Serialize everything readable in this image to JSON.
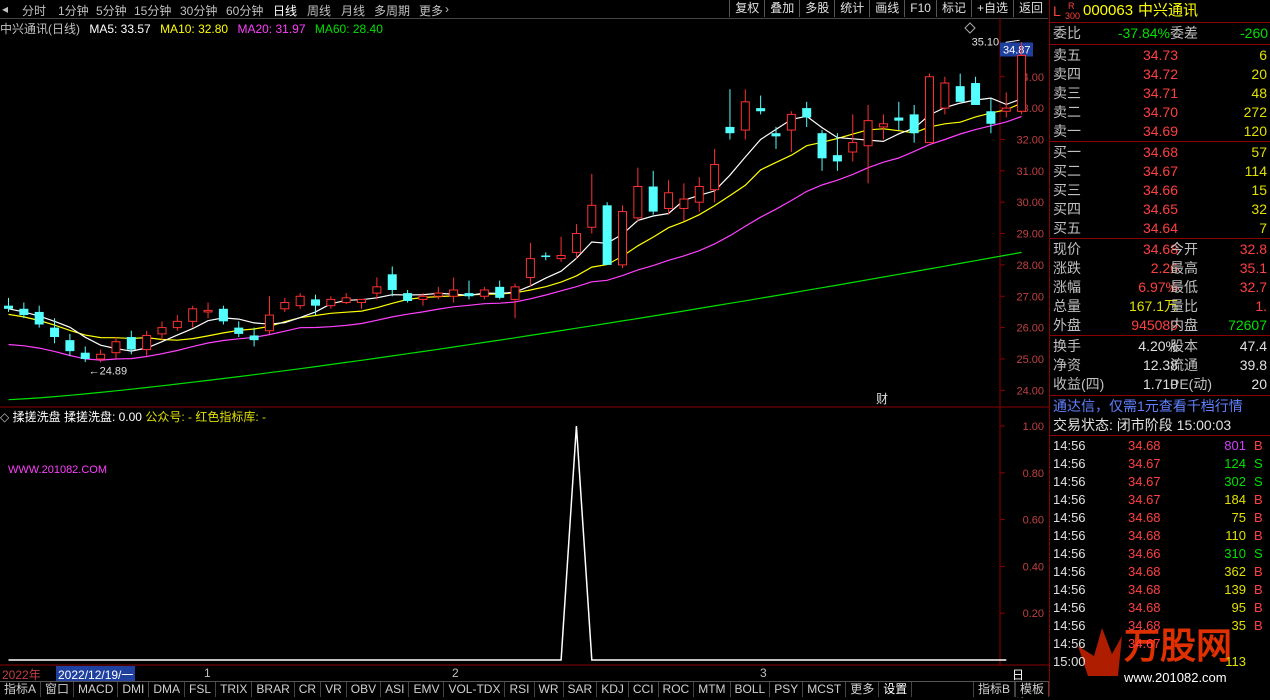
{
  "toolbar": {
    "periods": [
      "分时",
      "1分钟",
      "5分钟",
      "15分钟",
      "30分钟",
      "60分钟",
      "日线",
      "周线",
      "月线",
      "多周期",
      "更多"
    ],
    "active_period": "日线",
    "buttons": [
      "复权",
      "叠加",
      "多股",
      "统计",
      "画线",
      "F10",
      "标记",
      "+自选",
      "返回"
    ]
  },
  "main_legend": {
    "title": "中兴通讯(日线)",
    "ma5": "MA5: 33.57",
    "ma10": "MA10: 32.80",
    "ma20": "MA20: 31.97",
    "ma60": "MA60: 28.40",
    "colors": {
      "ma5": "#ffffff",
      "ma10": "#ffff00",
      "ma20": "#ff40ff",
      "ma60": "#00e000"
    }
  },
  "chart_data": [
    {
      "type": "candlestick",
      "title": "中兴通讯(日线)",
      "y_ticks": [
        "34.00",
        "33.00",
        "32.00",
        "31.00",
        "30.00",
        "29.00",
        "28.00",
        "27.00",
        "26.00",
        "25.00",
        "24.00"
      ],
      "ylim": [
        23.5,
        35.3
      ],
      "price_tag": "34.87",
      "annotations": {
        "high": "35.10",
        "low": "24.89",
        "marker": "财"
      },
      "candles": [
        {
          "o": 26.7,
          "h": 26.95,
          "l": 26.5,
          "c": 26.6
        },
        {
          "o": 26.6,
          "h": 26.8,
          "l": 26.3,
          "c": 26.4
        },
        {
          "o": 26.5,
          "h": 26.7,
          "l": 26.0,
          "c": 26.1
        },
        {
          "o": 26.0,
          "h": 26.3,
          "l": 25.5,
          "c": 25.7
        },
        {
          "o": 25.6,
          "h": 25.8,
          "l": 25.1,
          "c": 25.25
        },
        {
          "o": 25.2,
          "h": 25.4,
          "l": 24.9,
          "c": 25.0
        },
        {
          "o": 25.0,
          "h": 25.3,
          "l": 24.89,
          "c": 25.15
        },
        {
          "o": 25.2,
          "h": 25.7,
          "l": 25.0,
          "c": 25.55
        },
        {
          "o": 25.7,
          "h": 25.9,
          "l": 25.15,
          "c": 25.3
        },
        {
          "o": 25.3,
          "h": 25.9,
          "l": 25.1,
          "c": 25.75
        },
        {
          "o": 25.8,
          "h": 26.2,
          "l": 25.6,
          "c": 26.0
        },
        {
          "o": 26.0,
          "h": 26.4,
          "l": 25.9,
          "c": 26.2
        },
        {
          "o": 26.2,
          "h": 26.7,
          "l": 26.0,
          "c": 26.6
        },
        {
          "o": 26.5,
          "h": 26.8,
          "l": 26.3,
          "c": 26.55
        },
        {
          "o": 26.6,
          "h": 26.7,
          "l": 26.1,
          "c": 26.2
        },
        {
          "o": 26.0,
          "h": 26.2,
          "l": 25.7,
          "c": 25.8
        },
        {
          "o": 25.75,
          "h": 26.0,
          "l": 25.4,
          "c": 25.6
        },
        {
          "o": 25.9,
          "h": 27.0,
          "l": 25.8,
          "c": 26.4
        },
        {
          "o": 26.6,
          "h": 26.95,
          "l": 26.5,
          "c": 26.8
        },
        {
          "o": 26.7,
          "h": 27.1,
          "l": 26.6,
          "c": 27.0
        },
        {
          "o": 26.9,
          "h": 27.05,
          "l": 26.4,
          "c": 26.7
        },
        {
          "o": 26.7,
          "h": 27.0,
          "l": 26.6,
          "c": 26.9
        },
        {
          "o": 26.8,
          "h": 27.1,
          "l": 26.75,
          "c": 26.95
        },
        {
          "o": 26.8,
          "h": 26.9,
          "l": 26.6,
          "c": 26.9
        },
        {
          "o": 27.1,
          "h": 27.6,
          "l": 26.9,
          "c": 27.3
        },
        {
          "o": 27.7,
          "h": 27.95,
          "l": 27.0,
          "c": 27.2
        },
        {
          "o": 27.1,
          "h": 27.2,
          "l": 26.8,
          "c": 26.85
        },
        {
          "o": 26.9,
          "h": 27.1,
          "l": 26.7,
          "c": 27.0
        },
        {
          "o": 27.0,
          "h": 27.3,
          "l": 26.9,
          "c": 27.1
        },
        {
          "o": 27.0,
          "h": 27.6,
          "l": 26.8,
          "c": 27.2
        },
        {
          "o": 27.1,
          "h": 27.5,
          "l": 26.9,
          "c": 27.0
        },
        {
          "o": 27.0,
          "h": 27.3,
          "l": 26.9,
          "c": 27.2
        },
        {
          "o": 27.3,
          "h": 27.5,
          "l": 26.9,
          "c": 26.95
        },
        {
          "o": 26.9,
          "h": 27.4,
          "l": 26.3,
          "c": 27.3
        },
        {
          "o": 27.6,
          "h": 28.7,
          "l": 27.3,
          "c": 28.2
        },
        {
          "o": 28.3,
          "h": 28.4,
          "l": 28.15,
          "c": 28.25
        },
        {
          "o": 28.2,
          "h": 28.9,
          "l": 28.1,
          "c": 28.3
        },
        {
          "o": 28.4,
          "h": 29.3,
          "l": 28.2,
          "c": 29.0
        },
        {
          "o": 29.2,
          "h": 30.9,
          "l": 29.0,
          "c": 29.9
        },
        {
          "o": 29.9,
          "h": 30.0,
          "l": 28.0,
          "c": 28.0
        },
        {
          "o": 28.0,
          "h": 29.9,
          "l": 27.9,
          "c": 29.7
        },
        {
          "o": 29.5,
          "h": 31.1,
          "l": 29.4,
          "c": 30.5
        },
        {
          "o": 30.5,
          "h": 31.0,
          "l": 29.6,
          "c": 29.7
        },
        {
          "o": 29.8,
          "h": 30.7,
          "l": 29.6,
          "c": 30.3
        },
        {
          "o": 29.8,
          "h": 30.6,
          "l": 29.4,
          "c": 30.1
        },
        {
          "o": 30.0,
          "h": 30.8,
          "l": 29.7,
          "c": 30.5
        },
        {
          "o": 30.4,
          "h": 31.7,
          "l": 30.0,
          "c": 31.2
        },
        {
          "o": 32.4,
          "h": 33.6,
          "l": 32.0,
          "c": 32.2
        },
        {
          "o": 32.3,
          "h": 33.6,
          "l": 32.0,
          "c": 33.2
        },
        {
          "o": 33.0,
          "h": 33.4,
          "l": 32.8,
          "c": 32.9
        },
        {
          "o": 32.2,
          "h": 32.4,
          "l": 31.7,
          "c": 32.1
        },
        {
          "o": 32.3,
          "h": 32.9,
          "l": 31.6,
          "c": 32.8
        },
        {
          "o": 33.0,
          "h": 33.2,
          "l": 32.4,
          "c": 32.7
        },
        {
          "o": 32.2,
          "h": 32.3,
          "l": 31.0,
          "c": 31.4
        },
        {
          "o": 31.5,
          "h": 32.2,
          "l": 31.0,
          "c": 31.3
        },
        {
          "o": 31.6,
          "h": 32.8,
          "l": 31.3,
          "c": 31.9
        },
        {
          "o": 31.8,
          "h": 33.1,
          "l": 30.6,
          "c": 32.6
        },
        {
          "o": 32.4,
          "h": 32.8,
          "l": 32.0,
          "c": 32.5
        },
        {
          "o": 32.7,
          "h": 33.2,
          "l": 32.3,
          "c": 32.6
        },
        {
          "o": 32.8,
          "h": 33.1,
          "l": 31.9,
          "c": 32.2
        },
        {
          "o": 31.9,
          "h": 34.1,
          "l": 31.9,
          "c": 34.0
        },
        {
          "o": 33.0,
          "h": 34.0,
          "l": 32.8,
          "c": 33.8
        },
        {
          "o": 33.7,
          "h": 34.1,
          "l": 33.2,
          "c": 33.2
        },
        {
          "o": 33.8,
          "h": 34.0,
          "l": 33.1,
          "c": 33.1
        },
        {
          "o": 32.9,
          "h": 33.3,
          "l": 32.2,
          "c": 32.5
        },
        {
          "o": 32.9,
          "h": 33.5,
          "l": 32.7,
          "c": 33.0
        },
        {
          "o": 32.9,
          "h": 35.1,
          "l": 32.8,
          "c": 34.68
        }
      ]
    },
    {
      "type": "line",
      "title": "揉搓洗盘",
      "series_label": "揉搓洗盘: 0.00",
      "extra_labels": [
        "公众号: -",
        "红色指标库: -"
      ],
      "y_ticks": [
        "1.00",
        "0.80",
        "0.60",
        "0.40",
        "0.20"
      ],
      "ylim": [
        0,
        1
      ],
      "watermark": "WWW.201082.COM",
      "values": [
        0,
        0,
        0,
        0,
        0,
        0,
        0,
        0,
        0,
        0,
        0,
        0,
        0,
        0,
        0,
        0,
        0,
        0,
        0,
        0,
        0,
        0,
        0,
        0,
        0,
        0,
        0,
        0,
        0,
        0,
        0,
        0,
        0,
        0,
        0,
        0,
        0,
        1,
        0,
        0,
        0,
        0,
        0,
        0,
        0,
        0,
        0,
        0,
        0,
        0,
        0,
        0,
        0,
        0,
        0,
        0,
        0,
        0,
        0,
        0,
        0,
        0,
        0,
        0,
        0,
        0
      ]
    }
  ],
  "date_bar": {
    "year": "2022年",
    "cursor_date": "2022/12/19/一",
    "months": [
      "1",
      "2",
      "3"
    ],
    "period": "日线"
  },
  "tabs": [
    "指标A",
    "窗口",
    "MACD",
    "DMI",
    "DMA",
    "FSL",
    "TRIX",
    "BRAR",
    "CR",
    "VR",
    "OBV",
    "ASI",
    "EMV",
    "VOL-TDX",
    "RSI",
    "WR",
    "SAR",
    "KDJ",
    "CCI",
    "ROC",
    "MTM",
    "BOLL",
    "PSY",
    "MCST",
    "更多",
    "设置"
  ],
  "tabs_right": [
    "指标B",
    "模板"
  ],
  "quote": {
    "code": "000063",
    "name": "中兴通讯",
    "flags": [
      "L",
      "R",
      "300"
    ],
    "weibi_label": "委比",
    "weibi": "-37.84%",
    "weicha_label": "委差",
    "weicha": "-260",
    "asks": [
      {
        "label": "卖五",
        "price": "34.73",
        "vol": "6"
      },
      {
        "label": "卖四",
        "price": "34.72",
        "vol": "20"
      },
      {
        "label": "卖三",
        "price": "34.71",
        "vol": "48"
      },
      {
        "label": "卖二",
        "price": "34.70",
        "vol": "272"
      },
      {
        "label": "卖一",
        "price": "34.69",
        "vol": "120"
      }
    ],
    "bids": [
      {
        "label": "买一",
        "price": "34.68",
        "vol": "57"
      },
      {
        "label": "买二",
        "price": "34.67",
        "vol": "114"
      },
      {
        "label": "买三",
        "price": "34.66",
        "vol": "15"
      },
      {
        "label": "买四",
        "price": "34.65",
        "vol": "32"
      },
      {
        "label": "买五",
        "price": "34.64",
        "vol": "7"
      }
    ],
    "stats": [
      {
        "l1": "现价",
        "v1": "34.68",
        "c1": "red",
        "l2": "今开",
        "v2": "32.8",
        "c2": "red"
      },
      {
        "l1": "涨跌",
        "v1": "2.26",
        "c1": "red",
        "l2": "最高",
        "v2": "35.1",
        "c2": "red"
      },
      {
        "l1": "涨幅",
        "v1": "6.97%",
        "c1": "red",
        "l2": "最低",
        "v2": "32.7",
        "c2": "red"
      },
      {
        "l1": "总量",
        "v1": "167.1万",
        "c1": "yellow",
        "l2": "量比",
        "v2": "1.",
        "c2": "red"
      },
      {
        "l1": "外盘",
        "v1": "945089",
        "c1": "red",
        "l2": "内盘",
        "v2": "72607",
        "c2": "green"
      }
    ],
    "stats2": [
      {
        "l1": "换手",
        "v1": "4.20%",
        "l2": "股本",
        "v2": "47.4"
      },
      {
        "l1": "净资",
        "v1": "12.38",
        "l2": "流通",
        "v2": "39.8"
      },
      {
        "l1": "收益(四)",
        "v1": "1.710",
        "l2": "PE(动)",
        "v2": "20"
      }
    ],
    "promo": "通达信，仅需1元查看千档行情",
    "status": "交易状态: 闭市阶段 15:00:03",
    "ticks": [
      {
        "t": "14:56",
        "p": "34.68",
        "v": "801",
        "s": "B"
      },
      {
        "t": "14:56",
        "p": "34.67",
        "v": "124",
        "s": "S"
      },
      {
        "t": "14:56",
        "p": "34.67",
        "v": "302",
        "s": "S"
      },
      {
        "t": "14:56",
        "p": "34.67",
        "v": "184",
        "s": "B"
      },
      {
        "t": "14:56",
        "p": "34.68",
        "v": "75",
        "s": "B"
      },
      {
        "t": "14:56",
        "p": "34.68",
        "v": "110",
        "s": "B"
      },
      {
        "t": "14:56",
        "p": "34.66",
        "v": "310",
        "s": "S"
      },
      {
        "t": "14:56",
        "p": "34.68",
        "v": "362",
        "s": "B"
      },
      {
        "t": "14:56",
        "p": "34.68",
        "v": "139",
        "s": "B"
      },
      {
        "t": "14:56",
        "p": "34.68",
        "v": "95",
        "s": "B"
      },
      {
        "t": "14:56",
        "p": "34.68",
        "v": "35",
        "s": "B"
      },
      {
        "t": "14:56",
        "p": "34.67",
        "v": "",
        "s": ""
      },
      {
        "t": "15:00",
        "p": "",
        "v": "113",
        "s": ""
      }
    ],
    "logo_text": "万股网",
    "logo_url": "www.201082.com"
  }
}
